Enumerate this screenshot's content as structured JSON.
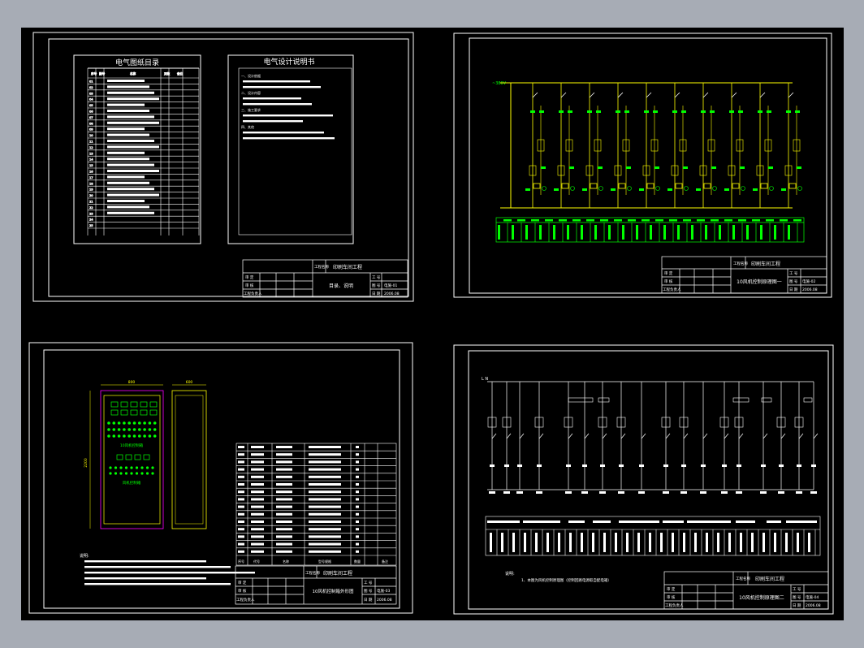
{
  "app": {
    "background": "#a7acb5",
    "model_space": "#000000",
    "line_white": "#ffffff",
    "line_yellow": "#ffff00",
    "line_green": "#00ff00",
    "line_cyan": "#00ffff",
    "line_magenta": "#ff00ff"
  },
  "sheet1": {
    "catalog_title": "电气图纸目录",
    "catalog_headers": [
      "序号",
      "图号",
      "名称",
      "页数",
      "备注"
    ],
    "catalog_rows": [
      "01",
      "02",
      "03",
      "04",
      "05",
      "06",
      "07",
      "08",
      "09",
      "10",
      "11",
      "12",
      "13",
      "14",
      "15",
      "16",
      "17",
      "18",
      "19",
      "20",
      "21",
      "22",
      "23",
      "24",
      "25"
    ],
    "spec_title": "电气设计说明书",
    "spec_lines": [
      "一、设计依据",
      "二、设计内容",
      "三、施工要求",
      "四、其他"
    ],
    "title_block": {
      "project_label": "工程名称",
      "project": "印刷车间工程",
      "drawing_name": "目录、说明",
      "row_labels": [
        "审 定",
        "审 核",
        "设 计",
        "工程负责人"
      ],
      "right_labels": [
        "工 号",
        "图 号",
        "日 期"
      ],
      "number": "电施-01",
      "date": "2006.08"
    }
  },
  "sheet2": {
    "bus_label": "~380V",
    "title_block": {
      "project_label": "工程名称",
      "project": "印刷车间工程",
      "drawing_name": "10风机控制原理图一",
      "row_labels": [
        "审 定",
        "审 核",
        "设 计",
        "工程负责人"
      ],
      "right_labels": [
        "工 号",
        "图 号",
        "日 期"
      ],
      "number": "电施-02",
      "date": "2006.08"
    }
  },
  "sheet3": {
    "dim_width": "800",
    "dim_depth": "600",
    "dim_height": "2200",
    "panel_label_1": "10风机控制箱",
    "panel_label_2": "风机控制箱",
    "notes_title": "说明:",
    "parts_headers": [
      "序号",
      "代号",
      "名称",
      "型号规格",
      "数量",
      "备注"
    ],
    "title_block": {
      "project_label": "工程名称",
      "project": "印刷车间工程",
      "drawing_name": "10风机控制箱外形图",
      "row_labels": [
        "审 定",
        "审 核",
        "设 计",
        "工程负责人"
      ],
      "right_labels": [
        "工 号",
        "图 号",
        "日 期"
      ],
      "number": "电施-03",
      "date": "2006.08"
    }
  },
  "sheet4": {
    "bus_label": "L N",
    "notes_title": "说明:",
    "notes_text": "1、本图为风机控制原理图（控制回路电源取自配电箱）",
    "title_block": {
      "project_label": "工程名称",
      "project": "印刷车间工程",
      "drawing_name": "10风机控制原理图二",
      "row_labels": [
        "审 定",
        "审 核",
        "设 计",
        "工程负责人"
      ],
      "right_labels": [
        "工 号",
        "图 号",
        "日 期"
      ],
      "number": "电施-04",
      "date": "2006.08"
    }
  }
}
